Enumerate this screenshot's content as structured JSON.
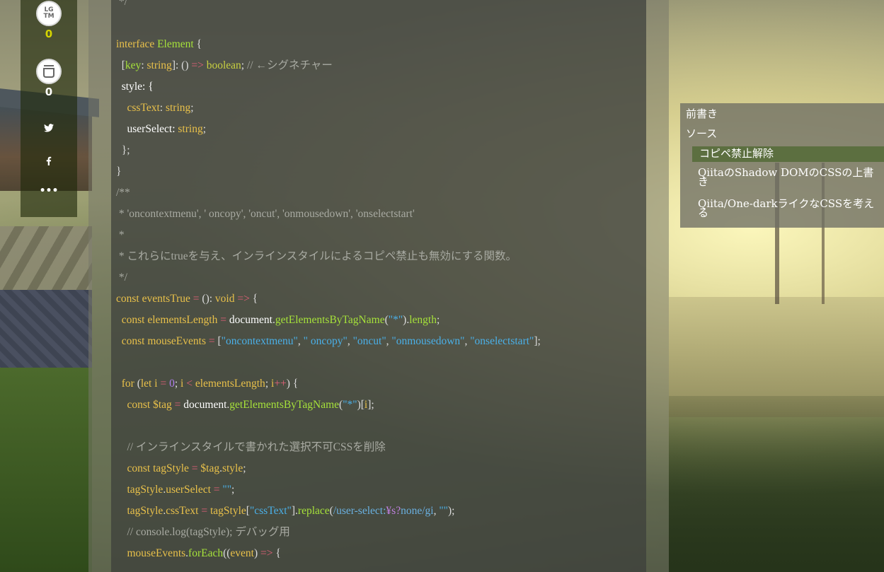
{
  "share": {
    "lgtm_label": "LG TM",
    "lgtm_count": "0",
    "stock_count": "0",
    "more_label": "•••"
  },
  "colors": {
    "keyword": "#e8c04a",
    "function": "#a6e23a",
    "string": "#4ab0e8",
    "comment": "#a8aaa2",
    "operator": "#e8607a",
    "lgtm_count": "#d4d400",
    "toc_active": "#5c6f40"
  },
  "code": {
    "l01": "*/",
    "l02": "",
    "l03_kw": "interface",
    "l03_ty": "Element",
    "l03_b": " {",
    "l04_a": "[",
    "l04_key": "key",
    "l04_b": ": ",
    "l04_ty": "string",
    "l04_c": "]: () ",
    "l04_op": "=>",
    "l04_sp": " ",
    "l04_ty2": "boolean",
    "l04_d": "; ",
    "l04_cm": "// ←シグネチャー",
    "l05": "style: {",
    "l06_prop": "cssText",
    "l06_b": ": ",
    "l06_ty": "string",
    "l06_c": ";",
    "l07_a": "userSelect: ",
    "l07_ty": "string",
    "l07_c": ";",
    "l08": "};",
    "l09": "}",
    "l10": "/**",
    "l11": " * 'oncontextmenu', ' oncopy', 'oncut', 'onmousedown', 'onselectstart'",
    "l12": " *",
    "l13": " * これらにtrueを与え、インラインスタイルによるコピペ禁止も無効にする関数。",
    "l14": " */",
    "l15_kw": "const",
    "l15_fn": "eventsTrue",
    "l15_op": "=",
    "l15_b": "(): ",
    "l15_ty": "void",
    "l15_op2": "=>",
    "l15_c": " {",
    "l16_kw": "const",
    "l16_fn": "elementsLength",
    "l16_op": "=",
    "l16_id": "document",
    "l16_b": ".",
    "l16_fn2": "getElementsByTagName",
    "l16_c": "(",
    "l16_str": "\"*\"",
    "l16_d": ").",
    "l16_fn3": "length",
    "l16_e": ";",
    "l17_kw": "const",
    "l17_fn": "mouseEvents",
    "l17_op": "=",
    "l17_b": "[",
    "l17_s1": "\"oncontextmenu\"",
    "l17_s2": "\" oncopy\"",
    "l17_s3": "\"oncut\"",
    "l17_s4": "\"onmousedown\"",
    "l17_s5": "\"onselectstart\"",
    "l17_comma": ", ",
    "l17_c": "];",
    "l18": "",
    "l19_kw": "for",
    "l19_b": " (",
    "l19_kw2": "let",
    "l19_sp": " ",
    "l19_fn": "i",
    "l19_op": "=",
    "l19_num": "0",
    "l19_c": "; ",
    "l19_fn2": "i",
    "l19_op2": "<",
    "l19_fn3": "elementsLength",
    "l19_d": "; ",
    "l19_fn4": "i",
    "l19_op3": "++",
    "l19_e": ") {",
    "l20_kw": "const",
    "l20_fn": "$tag",
    "l20_op": "=",
    "l20_id": "document",
    "l20_b": ".",
    "l20_fn2": "getElementsByTagName",
    "l20_c": "(",
    "l20_str": "\"*\"",
    "l20_d": ")[",
    "l20_fn3": "i",
    "l20_e": "];",
    "l21": "",
    "l22": "// インラインスタイルで書かれた選択不可CSSを削除",
    "l23_kw": "const",
    "l23_fn": "tagStyle",
    "l23_op": "=",
    "l23_fn2": "$tag",
    "l23_b": ".",
    "l23_fn3": "style",
    "l23_c": ";",
    "l24_fn": "tagStyle",
    "l24_b": ".",
    "l24_fn2": "userSelect",
    "l24_op": "=",
    "l24_str": "\"\"",
    "l24_c": ";",
    "l25_fn": "tagStyle",
    "l25_b": ".",
    "l25_fn2": "cssText",
    "l25_op": "=",
    "l25_fn3": "tagStyle",
    "l25_c": "[",
    "l25_str": "\"cssText\"",
    "l25_d": "].",
    "l25_fn4": "replace",
    "l25_e": "(",
    "l25_rx1": "/user-select:",
    "l25_esc": "¥s?",
    "l25_rx2": "none/gi",
    "l25_f": ", ",
    "l25_str2": "\"\"",
    "l25_g": ");",
    "l26": "// console.log(tagStyle); デバッグ用",
    "l27_fn": "mouseEvents",
    "l27_b": ".",
    "l27_fn2": "forEach",
    "l27_c": "((",
    "l27_fn3": "event",
    "l27_d": ") ",
    "l27_op": "=>",
    "l27_e": " {"
  },
  "toc": {
    "items": [
      {
        "label": "前書き"
      },
      {
        "label": "ソース"
      },
      {
        "label": "コピペ禁止解除"
      },
      {
        "label": "QiitaのShadow DOMのCSSの上書き"
      },
      {
        "label": "Qiita/One-darkライクなCSSを考える"
      }
    ]
  }
}
